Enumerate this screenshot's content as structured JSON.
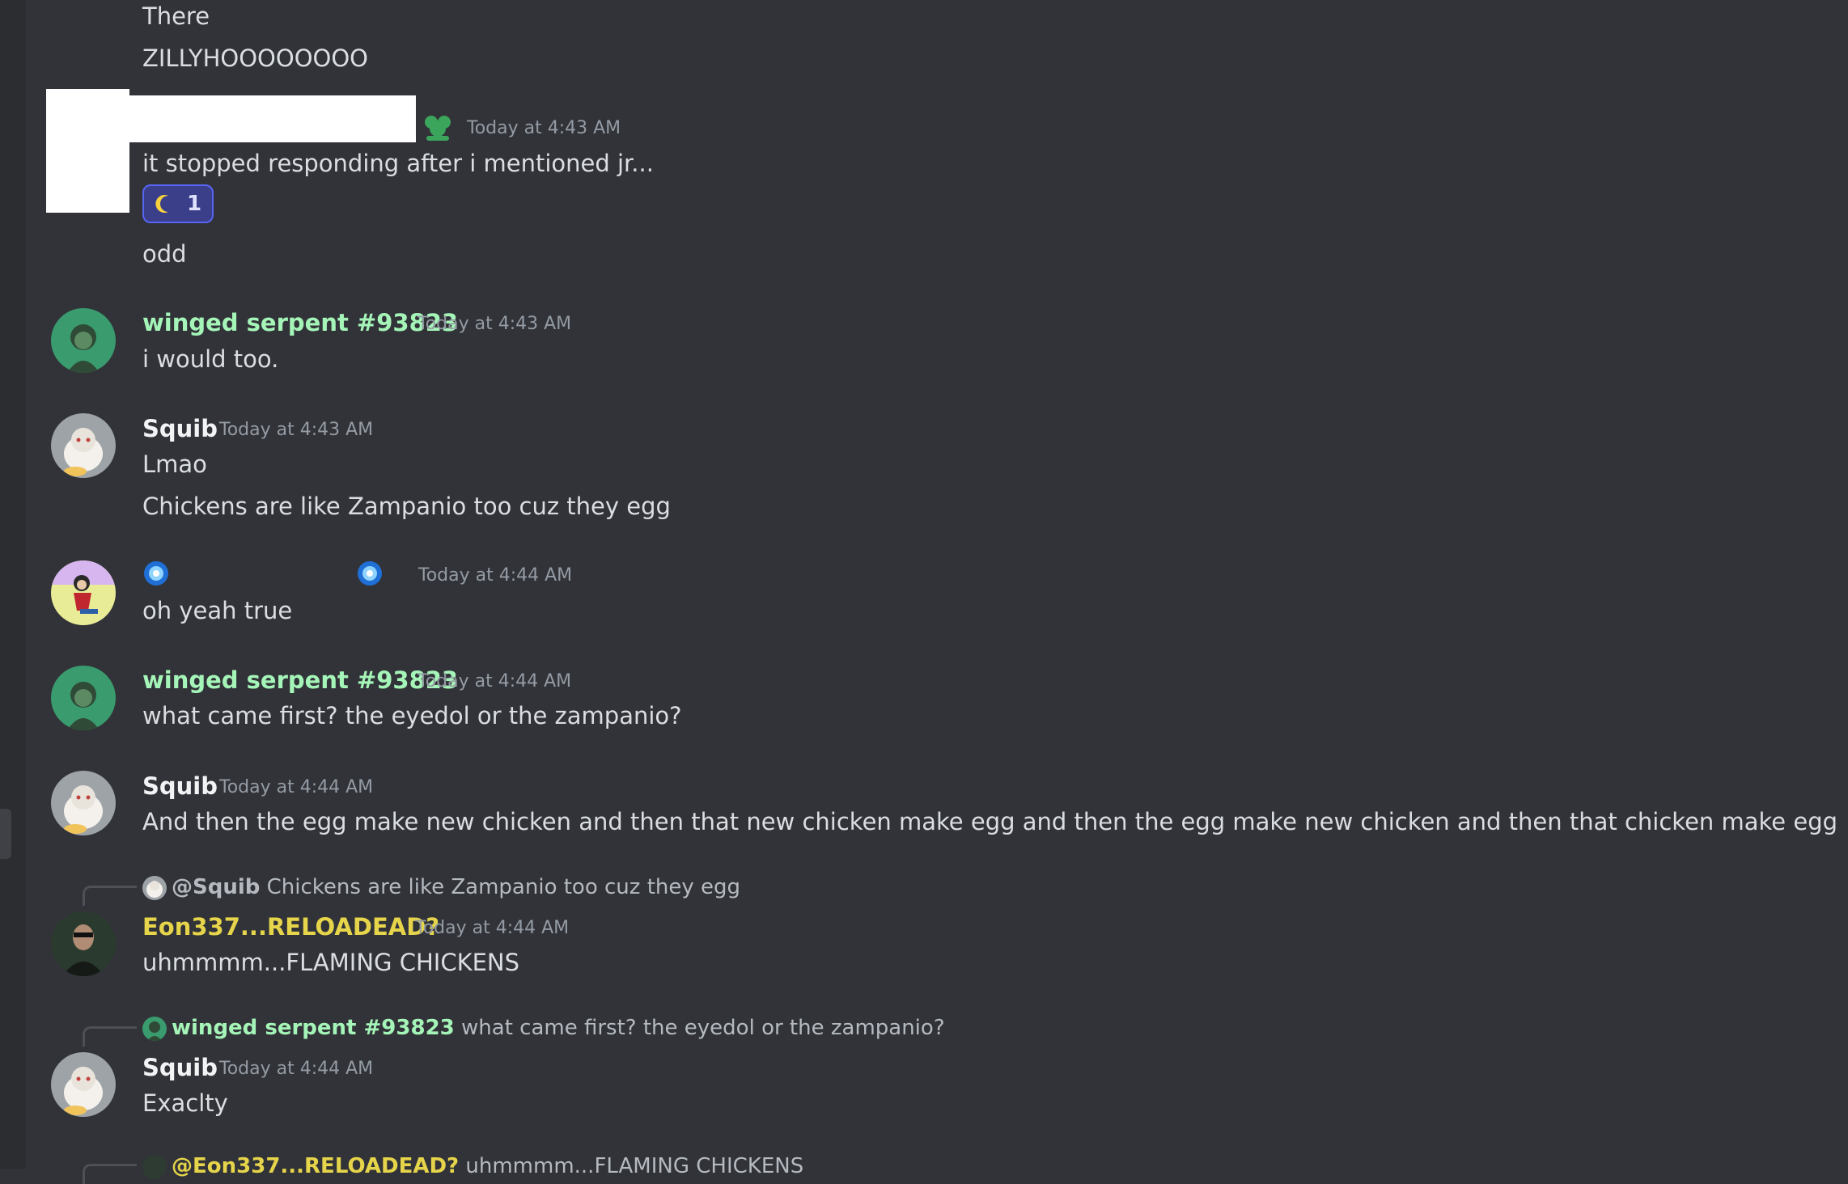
{
  "messages": {
    "top": {
      "line1": "There",
      "line2": "ZILLYHOOOOOOOO"
    },
    "redacted": {
      "timestamp": "Today at 4:43 AM",
      "badge_icon": "leaf-icon",
      "line1": "it stopped responding after i mentioned jr...",
      "reaction": {
        "icon": "crescent-moon-icon",
        "count": "1"
      },
      "line2": "odd"
    },
    "m1": {
      "author": "winged serpent #93823",
      "timestamp": "Today at 4:43 AM",
      "text": "i would too."
    },
    "m2": {
      "author": "Squib",
      "timestamp": "Today at 4:43 AM",
      "line1": "Lmao",
      "line2": "Chickens are like Zampanio too cuz they egg"
    },
    "m3": {
      "author_icons": [
        "blue-orb-icon",
        "crescent-moon-icon",
        "crescent-moon-icon",
        "crescent-moon-icon",
        "crescent-moon-icon",
        "crescent-moon-icon",
        "blue-orb-icon"
      ],
      "timestamp": "Today at 4:44 AM",
      "text": "oh yeah true"
    },
    "m4": {
      "author": "winged serpent #93823",
      "timestamp": "Today at 4:44 AM",
      "text": "what came first? the eyedol or the zampanio?"
    },
    "m5": {
      "author": "Squib",
      "timestamp": "Today at 4:44 AM",
      "text": "And then the egg make new chicken and then that new chicken make egg and then the egg make new chicken and then that chicken make egg"
    },
    "m6": {
      "reply_author": "@Squib",
      "reply_text": "Chickens are like Zampanio too cuz they egg",
      "author": "Eon337...RELOADEAD?",
      "timestamp": "Today at 4:44 AM",
      "text": "uhmmmm...FLAMING CHICKENS"
    },
    "m7": {
      "reply_author": "winged serpent #93823",
      "reply_text": "what came first? the eyedol or the zampanio?",
      "author": "Squib",
      "timestamp": "Today at 4:44 AM",
      "text": "Exaclty"
    },
    "m8": {
      "reply_author": "@Eon337...RELOADEAD?",
      "reply_text": "uhmmmm...FLAMING CHICKENS"
    }
  },
  "colors": {
    "background": "#313338",
    "text": "#dbdee1",
    "timestamp": "#949ba4",
    "green_name": "#a5f5b8",
    "yellow_name": "#e6d54a",
    "reaction_border": "#5865f2"
  }
}
